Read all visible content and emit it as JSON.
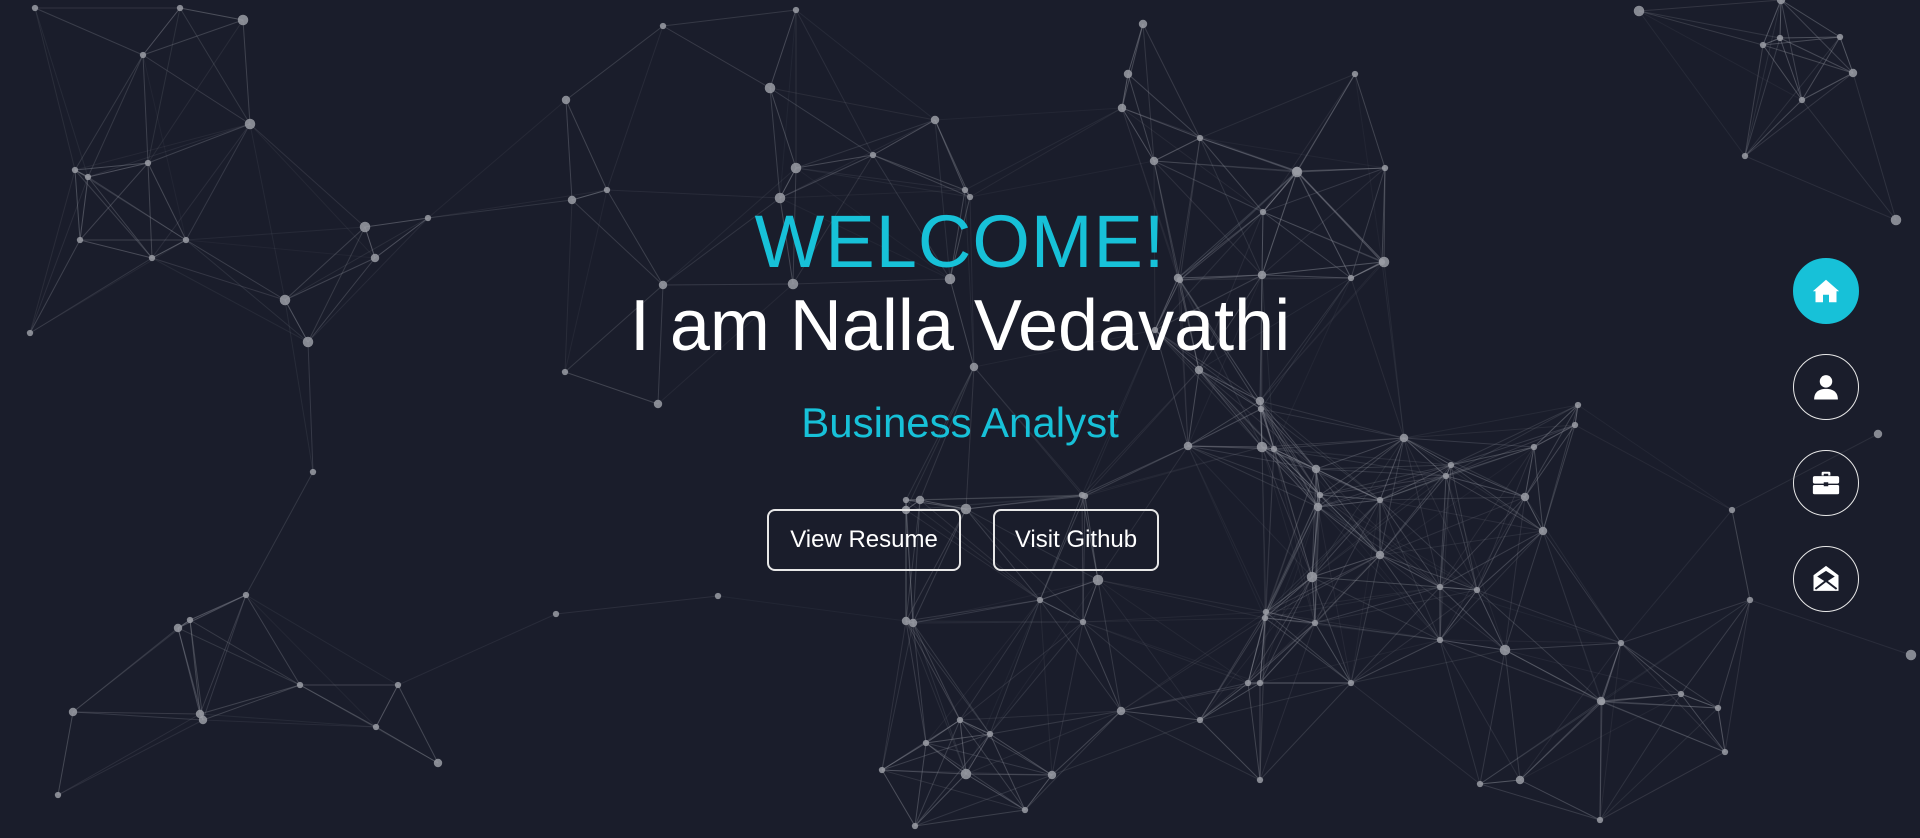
{
  "hero": {
    "welcome": "WELCOME!",
    "intro": "I am Nalla Vedavathi",
    "role": "Business Analyst"
  },
  "buttons": {
    "resume_label": "View Resume",
    "github_label": "Visit Github"
  },
  "side_nav": {
    "items": [
      {
        "icon": "home-icon",
        "active": true
      },
      {
        "icon": "user-icon",
        "active": false
      },
      {
        "icon": "briefcase-icon",
        "active": false
      },
      {
        "icon": "envelope-open-icon",
        "active": false
      }
    ]
  },
  "colors": {
    "background": "#1a1d2b",
    "accent": "#17c1d8",
    "text": "#ffffff",
    "network": "#8b8e98"
  }
}
